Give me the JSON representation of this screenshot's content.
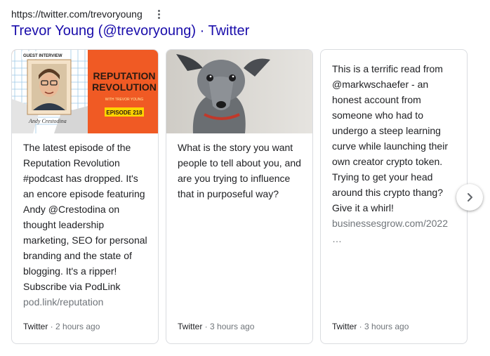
{
  "result": {
    "url": "https://twitter.com/trevoryoung",
    "title": "Trevor Young (@trevoryoung) · Twitter"
  },
  "cards": [
    {
      "image": {
        "badge": "GUEST INTERVIEW",
        "headline_1": "REPUTATION",
        "headline_2": "REVOLUTION",
        "sub": "WITH TREVOR YOUNG",
        "episode": "EPISODE 218",
        "signature": "Andy Crestodina"
      },
      "text": "The latest episode of the Reputation Revolution #podcast has dropped. It's an encore episode featuring Andy @Crestodina on thought leadership marketing, SEO for personal branding and the state of blogging. It's a ripper! Subscribe via PodLink",
      "link": "pod.link/reputation",
      "source": "Twitter",
      "time": " · 2 hours ago"
    },
    {
      "text": "What is the story you want people to tell about you, and are you trying to influence that in purposeful way?",
      "source": "Twitter",
      "time": " · 3 hours ago"
    },
    {
      "text": "This is a terrific read from @markwschaefer - an honest account from someone who had to undergo a steep learning curve while launching their own creator crypto token. Trying to get your head around this crypto thang? Give it a whirl!",
      "link": "businessesgrow.com/2022",
      "ellipsis": "…",
      "source": "Twitter",
      "time": " · 3 hours ago"
    }
  ],
  "colors": {
    "title_link": "#1a0dab",
    "muted": "#70757a",
    "orange": "#f05a24",
    "yellow": "#ffd400"
  }
}
